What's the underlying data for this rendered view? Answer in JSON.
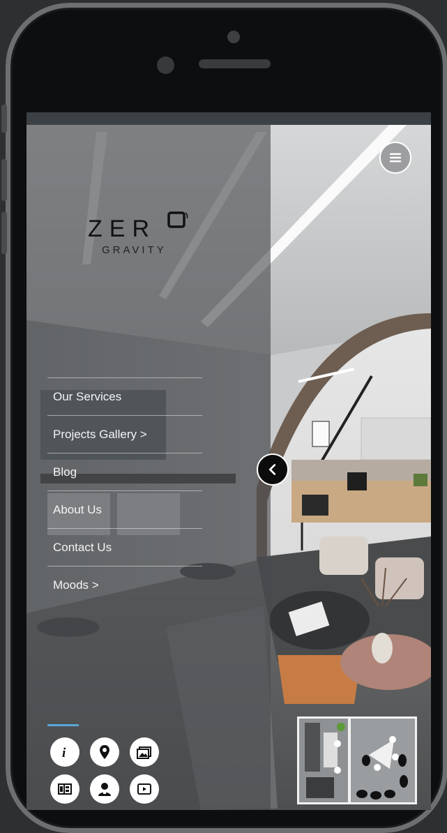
{
  "brand": {
    "logo_main": "ZER",
    "logo_sub": "GRAVITY"
  },
  "menu": {
    "items": [
      {
        "label": "Our Services"
      },
      {
        "label": "Projects Gallery >"
      },
      {
        "label": "Blog"
      },
      {
        "label": "About Us"
      },
      {
        "label": "Contact Us"
      },
      {
        "label": "Moods >"
      }
    ]
  },
  "toolbar": {
    "icons": [
      "info-icon",
      "location-pin-icon",
      "photo-gallery-icon",
      "floorplan-icon",
      "user-icon",
      "play-video-icon"
    ]
  },
  "controls": {
    "hamburger": "hamburger-menu-icon",
    "collapse": "chevron-left-icon",
    "minimap": "floor-plan-minimap"
  },
  "colors": {
    "accent_line": "#5aa7d8",
    "panel_overlay": "#484a4d",
    "device_frame": "#0d0e0f"
  }
}
